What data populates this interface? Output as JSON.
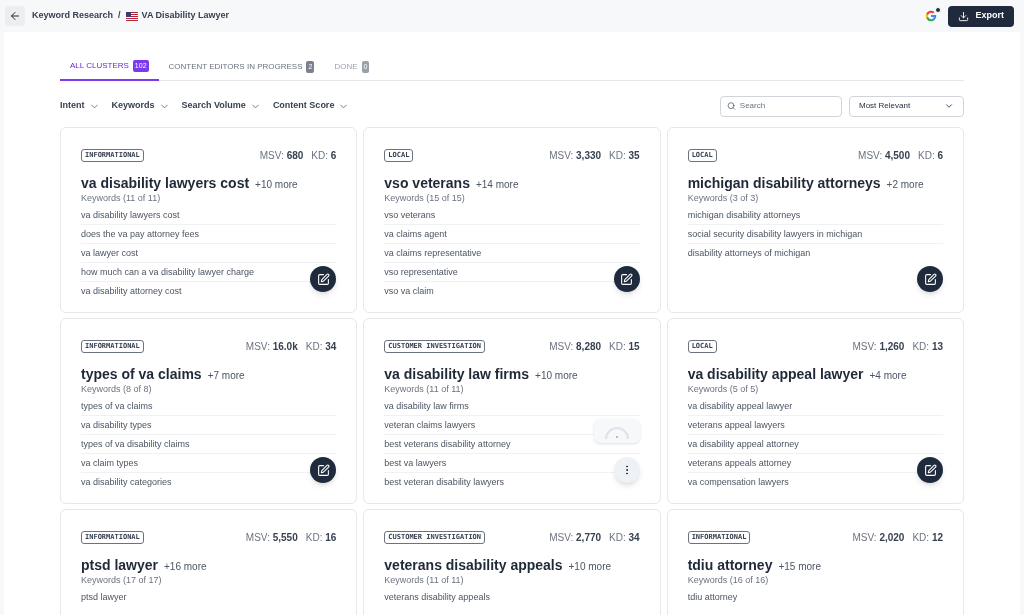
{
  "breadcrumb": {
    "parent": "Keyword Research",
    "separator": "/",
    "current": "VA Disability Lawyer"
  },
  "export_button": "Export",
  "tabs": [
    {
      "label": "ALL CLUSTERS",
      "count": "102",
      "selected": true
    },
    {
      "label": "CONTENT EDITORS IN PROGRESS",
      "count": "2",
      "selected": false
    },
    {
      "label": "DONE",
      "count": "0",
      "selected": false,
      "disabled": true
    }
  ],
  "filters": [
    "Intent",
    "Keywords",
    "Search Volume",
    "Content Score"
  ],
  "search": {
    "placeholder": "Search"
  },
  "sort": {
    "value": "Most Relevant"
  },
  "cards": [
    {
      "intent": "INFORMATIONAL",
      "msv_label": "MSV:",
      "msv": "680",
      "kd_label": "KD:",
      "kd": "6",
      "title": "va disability lawyers cost",
      "more": "+10 more",
      "keywords_label": "Keywords (11 of 11)",
      "keywords": [
        "va disability lawyers cost",
        "does the va pay attorney fees",
        "va lawyer cost",
        "how much can a va disability lawyer charge",
        "va disability attorney cost"
      ],
      "action": {
        "kind": "edit"
      }
    },
    {
      "intent": "LOCAL",
      "msv_label": "MSV:",
      "msv": "3,330",
      "kd_label": "KD:",
      "kd": "35",
      "title": "vso veterans",
      "more": "+14 more",
      "keywords_label": "Keywords (15 of 15)",
      "keywords": [
        "vso veterans",
        "va claims agent",
        "va claims representative",
        "vso representative",
        "vso va claim"
      ],
      "action": {
        "kind": "edit"
      }
    },
    {
      "intent": "LOCAL",
      "msv_label": "MSV:",
      "msv": "4,500",
      "kd_label": "KD:",
      "kd": "6",
      "title": "michigan disability attorneys",
      "more": "+2 more",
      "keywords_label": "Keywords (3 of 3)",
      "keywords": [
        "michigan disability attorneys",
        "social security disability lawyers in michigan",
        "disability attorneys of michigan"
      ],
      "action": {
        "kind": "edit"
      }
    },
    {
      "intent": "INFORMATIONAL",
      "msv_label": "MSV:",
      "msv": "16.0k",
      "kd_label": "KD:",
      "kd": "34",
      "title": "types of va claims",
      "more": "+7 more",
      "keywords_label": "Keywords (8 of 8)",
      "keywords": [
        "types of va claims",
        "va disability types",
        "types of va disability claims",
        "va claim types",
        "va disability categories"
      ],
      "action": {
        "kind": "edit"
      }
    },
    {
      "intent": "CUSTOMER INVESTIGATION",
      "msv_label": "MSV:",
      "msv": "8,280",
      "kd_label": "KD:",
      "kd": "15",
      "title": "va disability law firms",
      "more": "+10 more",
      "keywords_label": "Keywords (11 of 11)",
      "keywords": [
        "va disability law firms",
        "veteran claims lawyers",
        "best veterans disability attorney",
        "best va lawyers",
        "best veteran disability lawyers"
      ],
      "action": {
        "kind": "menu"
      },
      "loading": true
    },
    {
      "intent": "LOCAL",
      "msv_label": "MSV:",
      "msv": "1,260",
      "kd_label": "KD:",
      "kd": "13",
      "title": "va disability appeal lawyer",
      "more": "+4 more",
      "keywords_label": "Keywords (5 of 5)",
      "keywords": [
        "va disability appeal lawyer",
        "veterans appeal lawyers",
        "va disability appeal attorney",
        "veterans appeals attorney",
        "va compensation lawyers"
      ],
      "action": {
        "kind": "edit"
      }
    },
    {
      "intent": "INFORMATIONAL",
      "msv_label": "MSV:",
      "msv": "5,550",
      "kd_label": "KD:",
      "kd": "16",
      "title": "ptsd lawyer",
      "more": "+16 more",
      "keywords_label": "Keywords (17 of 17)",
      "keywords": [
        "ptsd lawyer"
      ]
    },
    {
      "intent": "CUSTOMER INVESTIGATION",
      "msv_label": "MSV:",
      "msv": "2,770",
      "kd_label": "KD:",
      "kd": "34",
      "title": "veterans disability appeals",
      "more": "+10 more",
      "keywords_label": "Keywords (11 of 11)",
      "keywords": [
        "veterans disability appeals"
      ]
    },
    {
      "intent": "INFORMATIONAL",
      "msv_label": "MSV:",
      "msv": "2,020",
      "kd_label": "KD:",
      "kd": "12",
      "title": "tdiu attorney",
      "more": "+15 more",
      "keywords_label": "Keywords (16 of 16)",
      "keywords": [
        "tdiu attorney"
      ]
    }
  ]
}
